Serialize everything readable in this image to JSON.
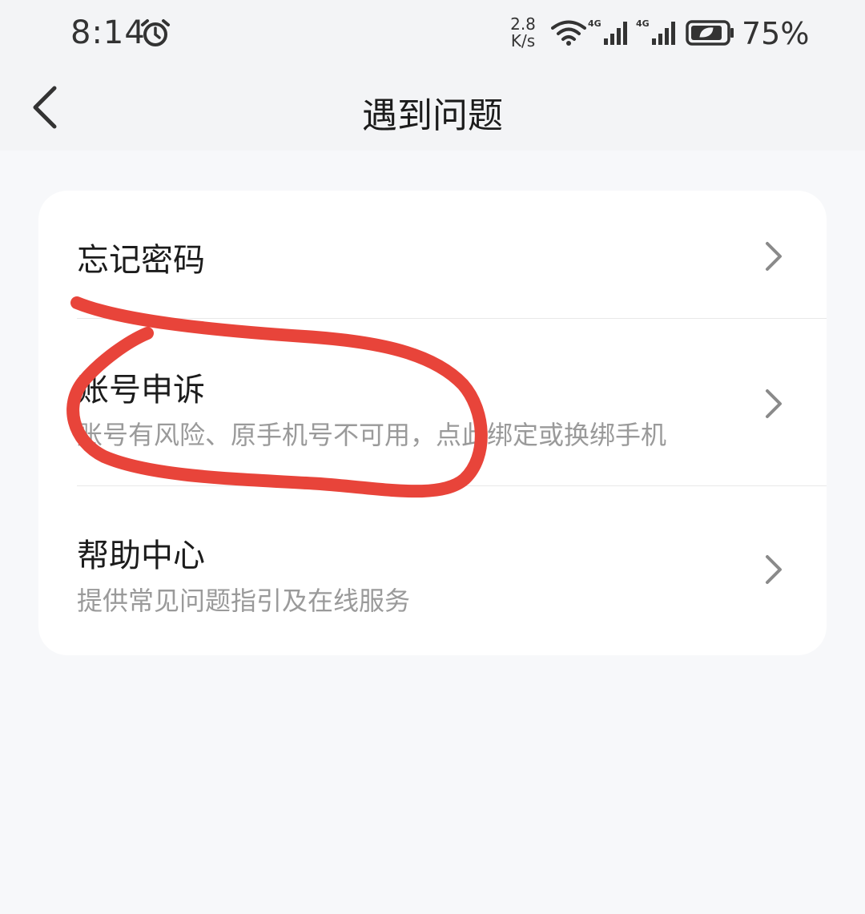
{
  "status_bar": {
    "time": "8:14",
    "net_speed_value": "2.8",
    "net_speed_unit": "K/s",
    "battery": "75%",
    "icons": [
      "alarm-icon",
      "wifi-icon",
      "signal-4g-icon",
      "signal-4g-icon",
      "battery-icon"
    ]
  },
  "header": {
    "title": "遇到问题",
    "back_icon": "chevron-left-icon"
  },
  "menu": {
    "items": [
      {
        "title": "忘记密码",
        "subtitle": ""
      },
      {
        "title": "账号申诉",
        "subtitle": "账号有风险、原手机号不可用，点此绑定或换绑手机"
      },
      {
        "title": "帮助中心",
        "subtitle": "提供常见问题指引及在线服务"
      }
    ]
  },
  "colors": {
    "background": "#f7f8fa",
    "card": "#ffffff",
    "title_text": "#1c1c1c",
    "subtitle_text": "#9a9a9a",
    "annotation_stroke": "#e8443a"
  }
}
